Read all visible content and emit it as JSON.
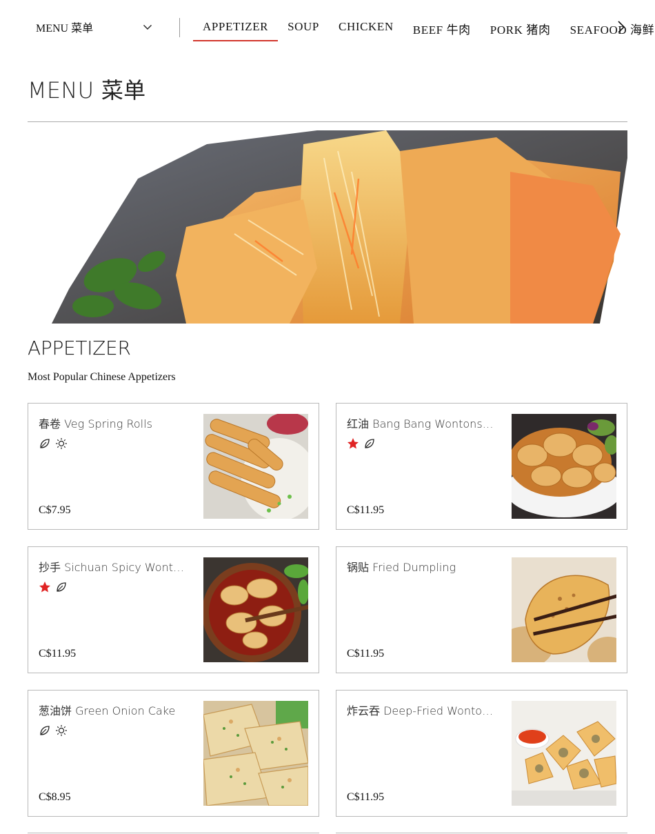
{
  "nav": {
    "menu_select_label": "MENU 菜单",
    "tabs": [
      {
        "label": "APPETIZER",
        "active": true
      },
      {
        "label": "SOUP"
      },
      {
        "label": "CHICKEN"
      },
      {
        "label": "BEEF 牛肉"
      },
      {
        "label": "PORK 猪肉"
      },
      {
        "label": "SEAFOOD 海鲜"
      }
    ],
    "next_icon": "chevron-right-icon",
    "accent_color": "#d2342a"
  },
  "page": {
    "title": "MENU 菜单"
  },
  "section": {
    "title": "APPETIZER",
    "description": "Most Popular Chinese Appetizers"
  },
  "items": [
    {
      "name": "春卷 Veg Spring Rolls",
      "price": "C$7.95",
      "badges": [
        "vegetarian-leaf-icon",
        "mild-sun-icon"
      ]
    },
    {
      "name": "红油 Bang Bang Wontons ...",
      "price": "C$11.95",
      "badges": [
        "popular-star-icon",
        "vegetarian-leaf-icon"
      ]
    },
    {
      "name": "抄手 Sichuan Spicy Wonton ...",
      "price": "C$11.95",
      "badges": [
        "popular-star-icon",
        "vegetarian-leaf-icon"
      ]
    },
    {
      "name": "锅贴 Fried Dumpling",
      "price": "C$11.95",
      "badges": []
    },
    {
      "name": "葱油饼 Green Onion Cake",
      "price": "C$8.95",
      "badges": [
        "vegetarian-leaf-icon",
        "mild-sun-icon"
      ]
    },
    {
      "name": "炸云吞 Deep-Fried Wontons ...",
      "price": "C$11.95",
      "badges": []
    }
  ]
}
